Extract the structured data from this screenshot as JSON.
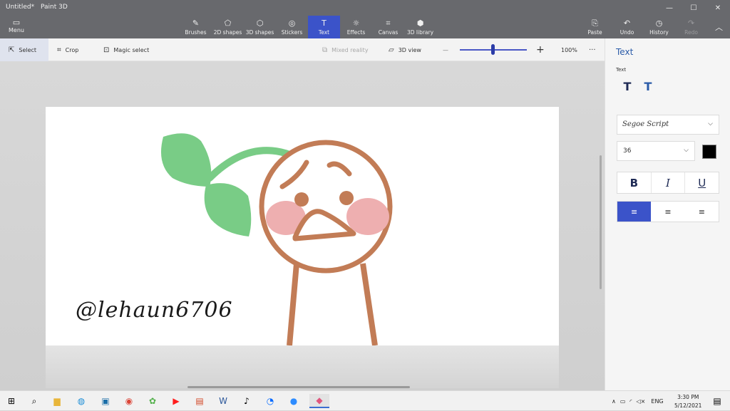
{
  "window": {
    "doc_title": "Untitled*",
    "app_title": "Paint 3D",
    "minimize": "—",
    "maximize": "☐",
    "close": "✕"
  },
  "ribbon": {
    "menu_label": "Menu",
    "tools": [
      {
        "label": "Brushes",
        "icon": "brush-icon",
        "glyph": "✎"
      },
      {
        "label": "2D shapes",
        "icon": "2d-shapes-icon",
        "glyph": "⬠"
      },
      {
        "label": "3D shapes",
        "icon": "3d-shapes-icon",
        "glyph": "⬡"
      },
      {
        "label": "Stickers",
        "icon": "stickers-icon",
        "glyph": "◎"
      },
      {
        "label": "Text",
        "icon": "text-icon",
        "glyph": "T"
      },
      {
        "label": "Effects",
        "icon": "effects-icon",
        "glyph": "☼"
      },
      {
        "label": "Canvas",
        "icon": "canvas-icon",
        "glyph": "⌗"
      },
      {
        "label": "3D library",
        "icon": "3d-library-icon",
        "glyph": "⬢"
      }
    ],
    "right_tools": [
      {
        "label": "Paste",
        "glyph": "⎘"
      },
      {
        "label": "Undo",
        "glyph": "↶"
      },
      {
        "label": "History",
        "glyph": "◷"
      },
      {
        "label": "Redo",
        "glyph": "↷"
      }
    ]
  },
  "toolbar": {
    "select": "Select",
    "crop": "Crop",
    "magic_select": "Magic select",
    "mixed_reality": "Mixed reality",
    "view_3d": "3D view",
    "zoom_minus": "—",
    "zoom_plus": "+",
    "zoom_level": "100%",
    "more": "···"
  },
  "canvas": {
    "handle_text": "@lehaun6706",
    "colors": {
      "skin": "#c27c56",
      "leaf": "#79cc86",
      "blush": "#eeafb0"
    }
  },
  "panel": {
    "title": "Text",
    "subtitle": "Text",
    "font": "Segoe Script",
    "size": "36",
    "color": "#000000",
    "bold": "B",
    "italic": "I",
    "underline": "U",
    "align_left": "≡",
    "align_center": "≡",
    "align_right": "≡"
  },
  "taskbar": {
    "tray_lang": "ENG",
    "time": "3:30 PM",
    "date": "5/12/2021"
  }
}
